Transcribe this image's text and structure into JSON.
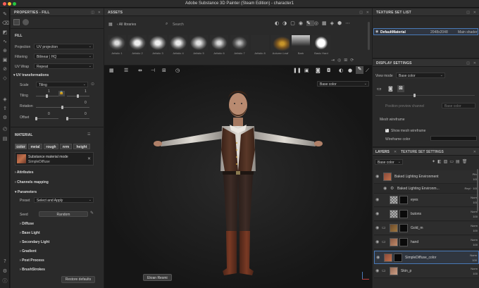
{
  "app": {
    "title": "Adobe Substance 3D Painter (Steam Edition) - character1"
  },
  "properties": {
    "header": "PROPERTIES - FILL",
    "fill_section": "FILL",
    "projection_label": "Projection",
    "projection_value": "UV projection",
    "filtering_label": "Filtering",
    "filtering_value": "Bilinear | HQ",
    "uvwrap_label": "UV Wrap",
    "uvwrap_value": "Repeat",
    "uvtrans_label": "UV transformations",
    "scale_label": "Scale",
    "scale_value": "Tiling",
    "tiling_label": "Tiling",
    "tiling_val1": "1",
    "tiling_val2": "1",
    "rotation_label": "Rotation",
    "rotation_val": "0",
    "offset_label": "Offset",
    "offset_val1": "0",
    "offset_val2": "0"
  },
  "material": {
    "header": "MATERIAL",
    "chips": [
      "color",
      "metal",
      "rough",
      "nrm",
      "height"
    ],
    "mode_title": "Substance material mode",
    "mode_value": "SimpleDiffuse",
    "sections": [
      "Attributes",
      "Channels mapping",
      "Parameters"
    ],
    "preset_label": "Preset",
    "preset_value": "Select and Apply",
    "seed_label": "Seed",
    "seed_value": "Random",
    "subsections": [
      "Diffuse",
      "Base Light",
      "Secondary Light",
      "Gradient",
      "Post Process",
      "BrushStrokes"
    ],
    "restore_label": "Restore defaults"
  },
  "assets": {
    "header": "ASSETS",
    "library": "All libraries",
    "search_placeholder": "Search",
    "brushes": [
      "Artistic 1",
      "Artistic 2",
      "Artistic 3",
      "Artistic 4",
      "Artistic 5",
      "Artistic 6",
      "Artistic 7",
      "Artistic 8",
      "Autumn Leaf",
      "Bark",
      "Basic Hard"
    ]
  },
  "viewport": {
    "channel_value": "Base color",
    "tooltip": "Ekran Resmi"
  },
  "texture_set_list": {
    "header": "TEXTURE SET LIST",
    "material_name": "DefaultMaterial",
    "resolution": "2048x2048",
    "shader": "Main shader"
  },
  "display_settings": {
    "header": "DISPLAY SETTINGS",
    "view_mode_label": "View mode",
    "view_mode_value": "Base color",
    "preview_channel_label": "Position preview channel",
    "preview_channel_value": "Base color",
    "mesh_wireframe_label": "Mesh wireframe",
    "show_wireframe_label": "Show mesh wireframe",
    "wireframe_color_label": "Wireframe color"
  },
  "layers": {
    "tab_layers": "LAYERS",
    "tab_tss": "TEXTURE SET SETTINGS",
    "channel_value": "Base color",
    "items": [
      {
        "name": "Baked Lighting Environment",
        "blend": "Pthr",
        "opacity": "100"
      },
      {
        "name": "Baked Lighting Environm...",
        "blend": "Repl",
        "opacity": "100"
      },
      {
        "name": "eyes",
        "blend": "Norm",
        "opacity": "100"
      },
      {
        "name": "butons",
        "blend": "Norm",
        "opacity": "100"
      },
      {
        "name": "Gold_m",
        "blend": "Norm",
        "opacity": "100"
      },
      {
        "name": "hand",
        "blend": "Norm",
        "opacity": "100"
      },
      {
        "name": "SimpleDiffuse_color",
        "blend": "Norm",
        "opacity": "100"
      },
      {
        "name": "Skin_p",
        "blend": "Norm",
        "opacity": "100"
      }
    ]
  },
  "colors": {
    "accent": "#4a7ab8",
    "panel": "#2a2a2a",
    "background": "#1e1e1e"
  }
}
